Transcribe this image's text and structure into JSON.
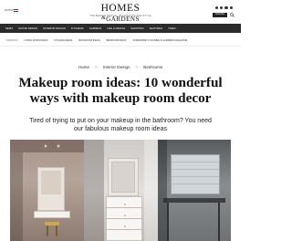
{
  "header": {
    "edition_label": "EDITION",
    "logo_line1": "HOMES",
    "logo_amp": "&",
    "logo_line2": "GARDENS",
    "tagline": "THE BEST IN DESIGN, DECORATION AND STYLE",
    "subscribe_label": "Subscribe"
  },
  "main_nav": [
    "NEWS",
    "HOUSE DESIGN",
    "INTERIOR DESIGN",
    "KITCHENS",
    "GARDENS",
    "LIFE & DESIGN",
    "SHOPPING",
    "FEATURES",
    "VIDEO"
  ],
  "sub_nav": {
    "trending_label": "TRENDING",
    "items": [
      "LIVING ROOM IDEAS",
      "KITCHEN IDEAS",
      "BATHROOM IDEAS",
      "BEDROOM IDEAS",
      "SUBSCRIBE TO HOMES & GARDENS MAGAZINE"
    ]
  },
  "breadcrumb": {
    "items": [
      "Home",
      "Interior Design",
      "Bedrooms"
    ],
    "separator": ">"
  },
  "article": {
    "title": "Makeup room ideas: 10 wonderful ways with makeup room decor",
    "standfirst": "Tired of trying to put on your makeup in the bathroom? You need our fabulous makeup room ideas"
  }
}
